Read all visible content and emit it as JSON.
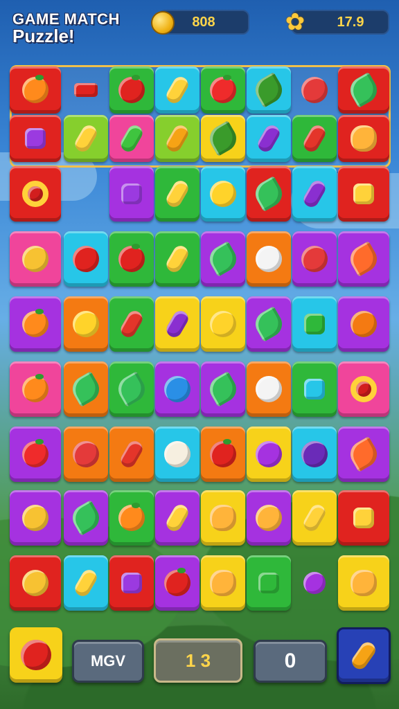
{
  "header": {
    "title_line1": "GAME MATCH",
    "title_line2": "Puzzle!",
    "coins": "808",
    "stars": "17.9"
  },
  "colors": {
    "red": "#e0231f",
    "green": "#2fb83a",
    "cyan": "#27c6e8",
    "purple": "#a532e0",
    "orange": "#f47a12",
    "yellow": "#f7d21a",
    "pink": "#f0459b",
    "lime": "#86cf2d"
  },
  "board": {
    "rows": [
      [
        {
          "tile": "red",
          "icon": "orange-icon"
        },
        {
          "tile": "none",
          "icon": "red-bar-icon"
        },
        {
          "tile": "green",
          "icon": "tomato-icon"
        },
        {
          "tile": "cyan",
          "icon": "banana-icon"
        },
        {
          "tile": "green",
          "icon": "apple-icon"
        },
        {
          "tile": "cyan",
          "icon": "herb-icon"
        },
        {
          "tile": "none",
          "icon": "strawberry-icon"
        },
        {
          "tile": "red",
          "icon": "leaf-icon"
        }
      ],
      [
        {
          "tile": "red",
          "icon": "popsicle-icon"
        },
        {
          "tile": "lime",
          "icon": "banana-icon"
        },
        {
          "tile": "pink",
          "icon": "cucumber-icon"
        },
        {
          "tile": "lime",
          "icon": "carrot-icon"
        },
        {
          "tile": "yellow",
          "icon": "herb-icon"
        },
        {
          "tile": "cyan",
          "icon": "eggplant-icon"
        },
        {
          "tile": "green",
          "icon": "chili-icon"
        },
        {
          "tile": "red",
          "icon": "chick-icon"
        }
      ],
      [
        {
          "tile": "red",
          "icon": "ring-icon"
        },
        {
          "tile": "none",
          "icon": "empty"
        },
        {
          "tile": "purple",
          "icon": "popsicle-icon"
        },
        {
          "tile": "green",
          "icon": "banana-icon"
        },
        {
          "tile": "cyan",
          "icon": "lemon-icon"
        },
        {
          "tile": "red",
          "icon": "leaf-icon"
        },
        {
          "tile": "cyan",
          "icon": "eggplant-icon"
        },
        {
          "tile": "red",
          "icon": "house-icon"
        }
      ],
      [
        {
          "tile": "pink",
          "icon": "melon-icon"
        },
        {
          "tile": "cyan",
          "icon": "cherry-icon"
        },
        {
          "tile": "green",
          "icon": "tomato-icon"
        },
        {
          "tile": "green",
          "icon": "banana-icon"
        },
        {
          "tile": "purple",
          "icon": "leaf-icon"
        },
        {
          "tile": "orange",
          "icon": "coconut-icon"
        },
        {
          "tile": "purple",
          "icon": "strawberry-icon"
        },
        {
          "tile": "purple",
          "icon": "flower-icon"
        }
      ],
      [
        {
          "tile": "purple",
          "icon": "orange-icon"
        },
        {
          "tile": "orange",
          "icon": "lemon-icon"
        },
        {
          "tile": "green",
          "icon": "chili-icon"
        },
        {
          "tile": "yellow",
          "icon": "eggplant-icon"
        },
        {
          "tile": "yellow",
          "icon": "lemon-icon"
        },
        {
          "tile": "purple",
          "icon": "leaf-icon"
        },
        {
          "tile": "cyan",
          "icon": "square-icon"
        },
        {
          "tile": "purple",
          "icon": "mango-icon"
        }
      ],
      [
        {
          "tile": "pink",
          "icon": "orange-icon"
        },
        {
          "tile": "orange",
          "icon": "leaf-icon"
        },
        {
          "tile": "green",
          "icon": "leaf-icon"
        },
        {
          "tile": "purple",
          "icon": "berry-icon"
        },
        {
          "tile": "purple",
          "icon": "leaf-icon"
        },
        {
          "tile": "orange",
          "icon": "donut-icon"
        },
        {
          "tile": "green",
          "icon": "gem-icon"
        },
        {
          "tile": "pink",
          "icon": "ring-icon"
        }
      ],
      [
        {
          "tile": "purple",
          "icon": "apple-icon"
        },
        {
          "tile": "orange",
          "icon": "strawberry-icon"
        },
        {
          "tile": "orange",
          "icon": "chili-icon"
        },
        {
          "tile": "cyan",
          "icon": "garlic-icon"
        },
        {
          "tile": "orange",
          "icon": "tomato-icon"
        },
        {
          "tile": "yellow",
          "icon": "onion-icon"
        },
        {
          "tile": "cyan",
          "icon": "plum-icon"
        },
        {
          "tile": "purple",
          "icon": "flower-icon"
        }
      ],
      [
        {
          "tile": "purple",
          "icon": "melon-icon"
        },
        {
          "tile": "purple",
          "icon": "leaf-icon"
        },
        {
          "tile": "green",
          "icon": "orange-icon"
        },
        {
          "tile": "purple",
          "icon": "banana-icon"
        },
        {
          "tile": "yellow",
          "icon": "chick-icon"
        },
        {
          "tile": "purple",
          "icon": "grapes-icon"
        },
        {
          "tile": "yellow",
          "icon": "banana-icon"
        },
        {
          "tile": "red",
          "icon": "house-icon"
        }
      ],
      [
        {
          "tile": "red",
          "icon": "melon-icon"
        },
        {
          "tile": "cyan",
          "icon": "banana-icon"
        },
        {
          "tile": "red",
          "icon": "popsicle-icon"
        },
        {
          "tile": "purple",
          "icon": "tomato-icon"
        },
        {
          "tile": "yellow",
          "icon": "chick-icon"
        },
        {
          "tile": "green",
          "icon": "square-icon"
        },
        {
          "tile": "none",
          "icon": "grape-icon"
        },
        {
          "tile": "yellow",
          "icon": "chick-icon"
        }
      ]
    ]
  },
  "footer": {
    "left_label": "MGV",
    "moves": "1 3",
    "score": "0"
  }
}
